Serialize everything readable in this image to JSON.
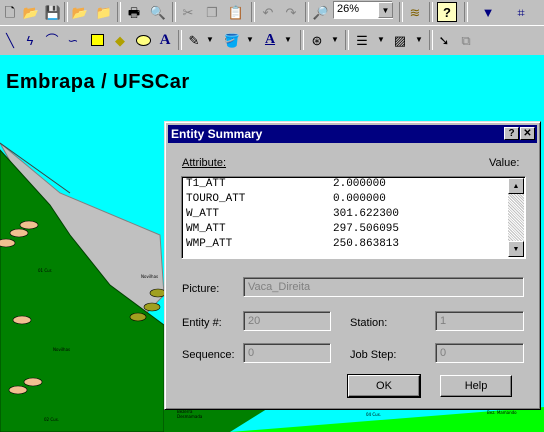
{
  "toolbar_top": {
    "zoom_value": "26%",
    "icons": [
      "new-file-icon",
      "open-folder-icon",
      "save-icon",
      "open-model-icon",
      "save-model-icon",
      "print-icon",
      "print-preview-icon",
      "cut-icon",
      "copy-icon",
      "paste-icon",
      "undo-icon",
      "redo-icon",
      "zoom-icon",
      "layers-icon",
      "help-icon",
      "pointer-icon",
      "snap-icon"
    ]
  },
  "toolbar_draw": {
    "icons": [
      "line-icon",
      "polyline-icon",
      "arc-icon",
      "bezier-icon",
      "rectangle-icon",
      "polygon-icon",
      "ellipse-icon",
      "text-icon",
      "line-color-icon",
      "fill-color-icon",
      "text-color-icon",
      "fill-pattern-icon",
      "line-width-icon",
      "hatch-icon",
      "arrowhead-icon",
      "grid-snap-icon"
    ]
  },
  "canvas": {
    "title": "Embrapa / UFSCar",
    "sky_color": "#00ffff",
    "grass_color": "#008000",
    "light_grass_color": "#00ff00",
    "road_color": "#c0c0c0",
    "area_labels": [
      "01 Cur.",
      "Novilhas",
      "Novilhas",
      "02 Cus.",
      "Bezerra Desmamada",
      "04 Cus.",
      "Bez. Mamando"
    ]
  },
  "dialog": {
    "title": "Entity Summary",
    "help_button": "?",
    "close_button": "✕",
    "attribute_label": "Attribute:",
    "value_label": "Value:",
    "attributes": [
      {
        "name": "T1_ATT",
        "value": "2.000000"
      },
      {
        "name": "TOURO_ATT",
        "value": "0.000000"
      },
      {
        "name": "W_ATT",
        "value": "301.622300"
      },
      {
        "name": "WM_ATT",
        "value": "297.506095"
      },
      {
        "name": "WMP_ATT",
        "value": "250.863813"
      }
    ],
    "picture_label": "Picture:",
    "picture_value": "Vaca_Direita",
    "entity_label": "Entity #:",
    "entity_value": "20",
    "station_label": "Station:",
    "station_value": "1",
    "sequence_label": "Sequence:",
    "sequence_value": "0",
    "jobstep_label": "Job Step:",
    "jobstep_value": "0",
    "ok_label": "OK",
    "help_label": "Help"
  }
}
